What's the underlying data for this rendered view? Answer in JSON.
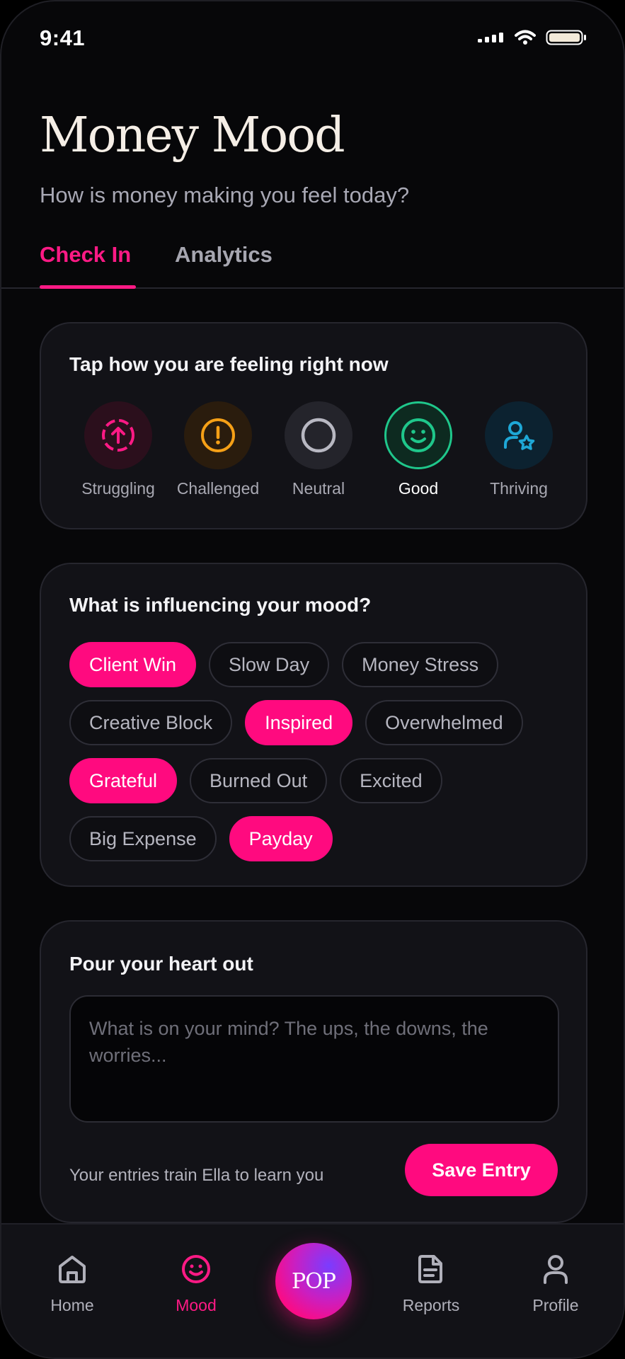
{
  "status_bar": {
    "time": "9:41"
  },
  "header": {
    "title": "Money Mood",
    "subtitle": "How is money making you feel today?"
  },
  "tabs": [
    {
      "label": "Check In",
      "active": true
    },
    {
      "label": "Analytics",
      "active": false
    }
  ],
  "mood_card": {
    "title": "Tap how you are feeling right now",
    "moods": [
      {
        "label": "Struggling",
        "icon": "arrow-up-circle-icon",
        "color": "#ff1a85",
        "selected": false
      },
      {
        "label": "Challenged",
        "icon": "alert-circle-icon",
        "color": "#f5a017",
        "selected": false
      },
      {
        "label": "Neutral",
        "icon": "circle-icon",
        "color": "#b8b8c2",
        "selected": false
      },
      {
        "label": "Good",
        "icon": "smile-icon",
        "color": "#1fc78b",
        "selected": true
      },
      {
        "label": "Thriving",
        "icon": "user-star-icon",
        "color": "#1ea7d6",
        "selected": false
      }
    ]
  },
  "influence_card": {
    "title": "What is influencing your mood?",
    "chips": [
      {
        "label": "Client Win",
        "selected": true
      },
      {
        "label": "Slow Day",
        "selected": false
      },
      {
        "label": "Money Stress",
        "selected": false
      },
      {
        "label": "Creative Block",
        "selected": false
      },
      {
        "label": "Inspired",
        "selected": true
      },
      {
        "label": "Overwhelmed",
        "selected": false
      },
      {
        "label": "Grateful",
        "selected": true
      },
      {
        "label": "Burned Out",
        "selected": false
      },
      {
        "label": "Excited",
        "selected": false
      },
      {
        "label": "Big Expense",
        "selected": false
      },
      {
        "label": "Payday",
        "selected": true
      }
    ]
  },
  "journal_card": {
    "title": "Pour your heart out",
    "placeholder": "What is on your mind? The ups, the downs, the worries...",
    "value": "",
    "hint": "Your entries train Ella to learn you",
    "save_label": "Save Entry"
  },
  "nav": {
    "items": [
      {
        "label": "Home",
        "icon": "home-icon",
        "active": false
      },
      {
        "label": "Mood",
        "icon": "smile-icon",
        "active": true
      },
      {
        "label": "Reports",
        "icon": "document-icon",
        "active": false
      },
      {
        "label": "Profile",
        "icon": "user-icon",
        "active": false
      }
    ],
    "center_button": "POP"
  },
  "colors": {
    "accent": "#ff0a7f",
    "background": "#070709",
    "card": "#121217"
  }
}
